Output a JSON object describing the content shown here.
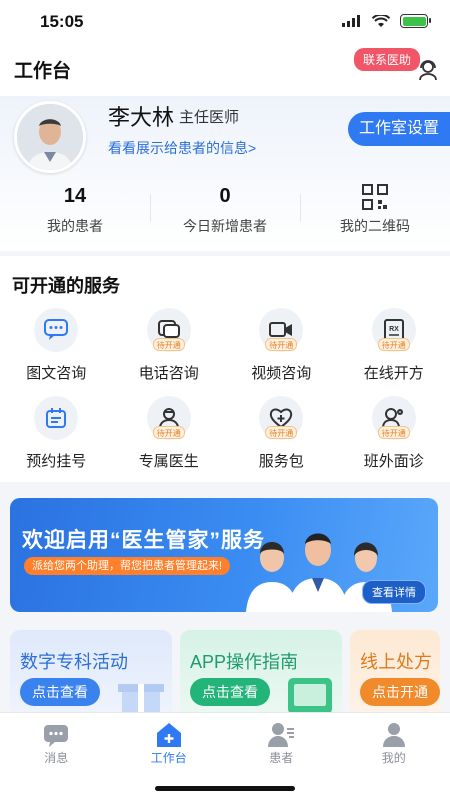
{
  "status_bar": {
    "time": "15:05"
  },
  "header": {
    "title": "工作台",
    "contact_badge": "联系医助"
  },
  "profile": {
    "name": "李大林",
    "title": "主任医师",
    "info_link": "看看展示给患者的信息>",
    "studio_button": "工作室设置",
    "stats": [
      {
        "value": "14",
        "label": "我的患者"
      },
      {
        "value": "0",
        "label": "今日新增患者"
      },
      {
        "label": "我的二维码"
      }
    ]
  },
  "services": {
    "title": "可开通的服务",
    "items": [
      {
        "label": "图文咨询",
        "icon": "chat-icon",
        "tag": ""
      },
      {
        "label": "电话咨询",
        "icon": "phone-chat-icon",
        "tag": "待开通"
      },
      {
        "label": "视频咨询",
        "icon": "video-icon",
        "tag": "待开通"
      },
      {
        "label": "在线开方",
        "icon": "prescription-icon",
        "tag": "待开通"
      },
      {
        "label": "预约挂号",
        "icon": "calendar-icon",
        "tag": ""
      },
      {
        "label": "专属医生",
        "icon": "doctor-icon",
        "tag": "待开通"
      },
      {
        "label": "服务包",
        "icon": "service-pack-icon",
        "tag": "待开通"
      },
      {
        "label": "班外面诊",
        "icon": "consult-icon",
        "tag": "待开通"
      }
    ]
  },
  "banner": {
    "title": "欢迎启用“医生管家”服务",
    "subtitle": "派给您两个助理，帮您把患者管理起来!",
    "button": "查看详情"
  },
  "cards": [
    {
      "title": "数字专科活动",
      "button": "点击查看"
    },
    {
      "title": "APP操作指南",
      "button": "点击查看"
    },
    {
      "title": "线上处方",
      "button": "点击开通"
    }
  ],
  "tabbar": [
    {
      "label": "消息",
      "icon": "message-icon",
      "active": false
    },
    {
      "label": "工作台",
      "icon": "workbench-icon",
      "active": true
    },
    {
      "label": "患者",
      "icon": "patient-icon",
      "active": false
    },
    {
      "label": "我的",
      "icon": "profile-icon",
      "active": false
    }
  ],
  "colors": {
    "primary": "#2f7af2",
    "badge": "#f05568",
    "tag_orange": "#e0802a"
  }
}
